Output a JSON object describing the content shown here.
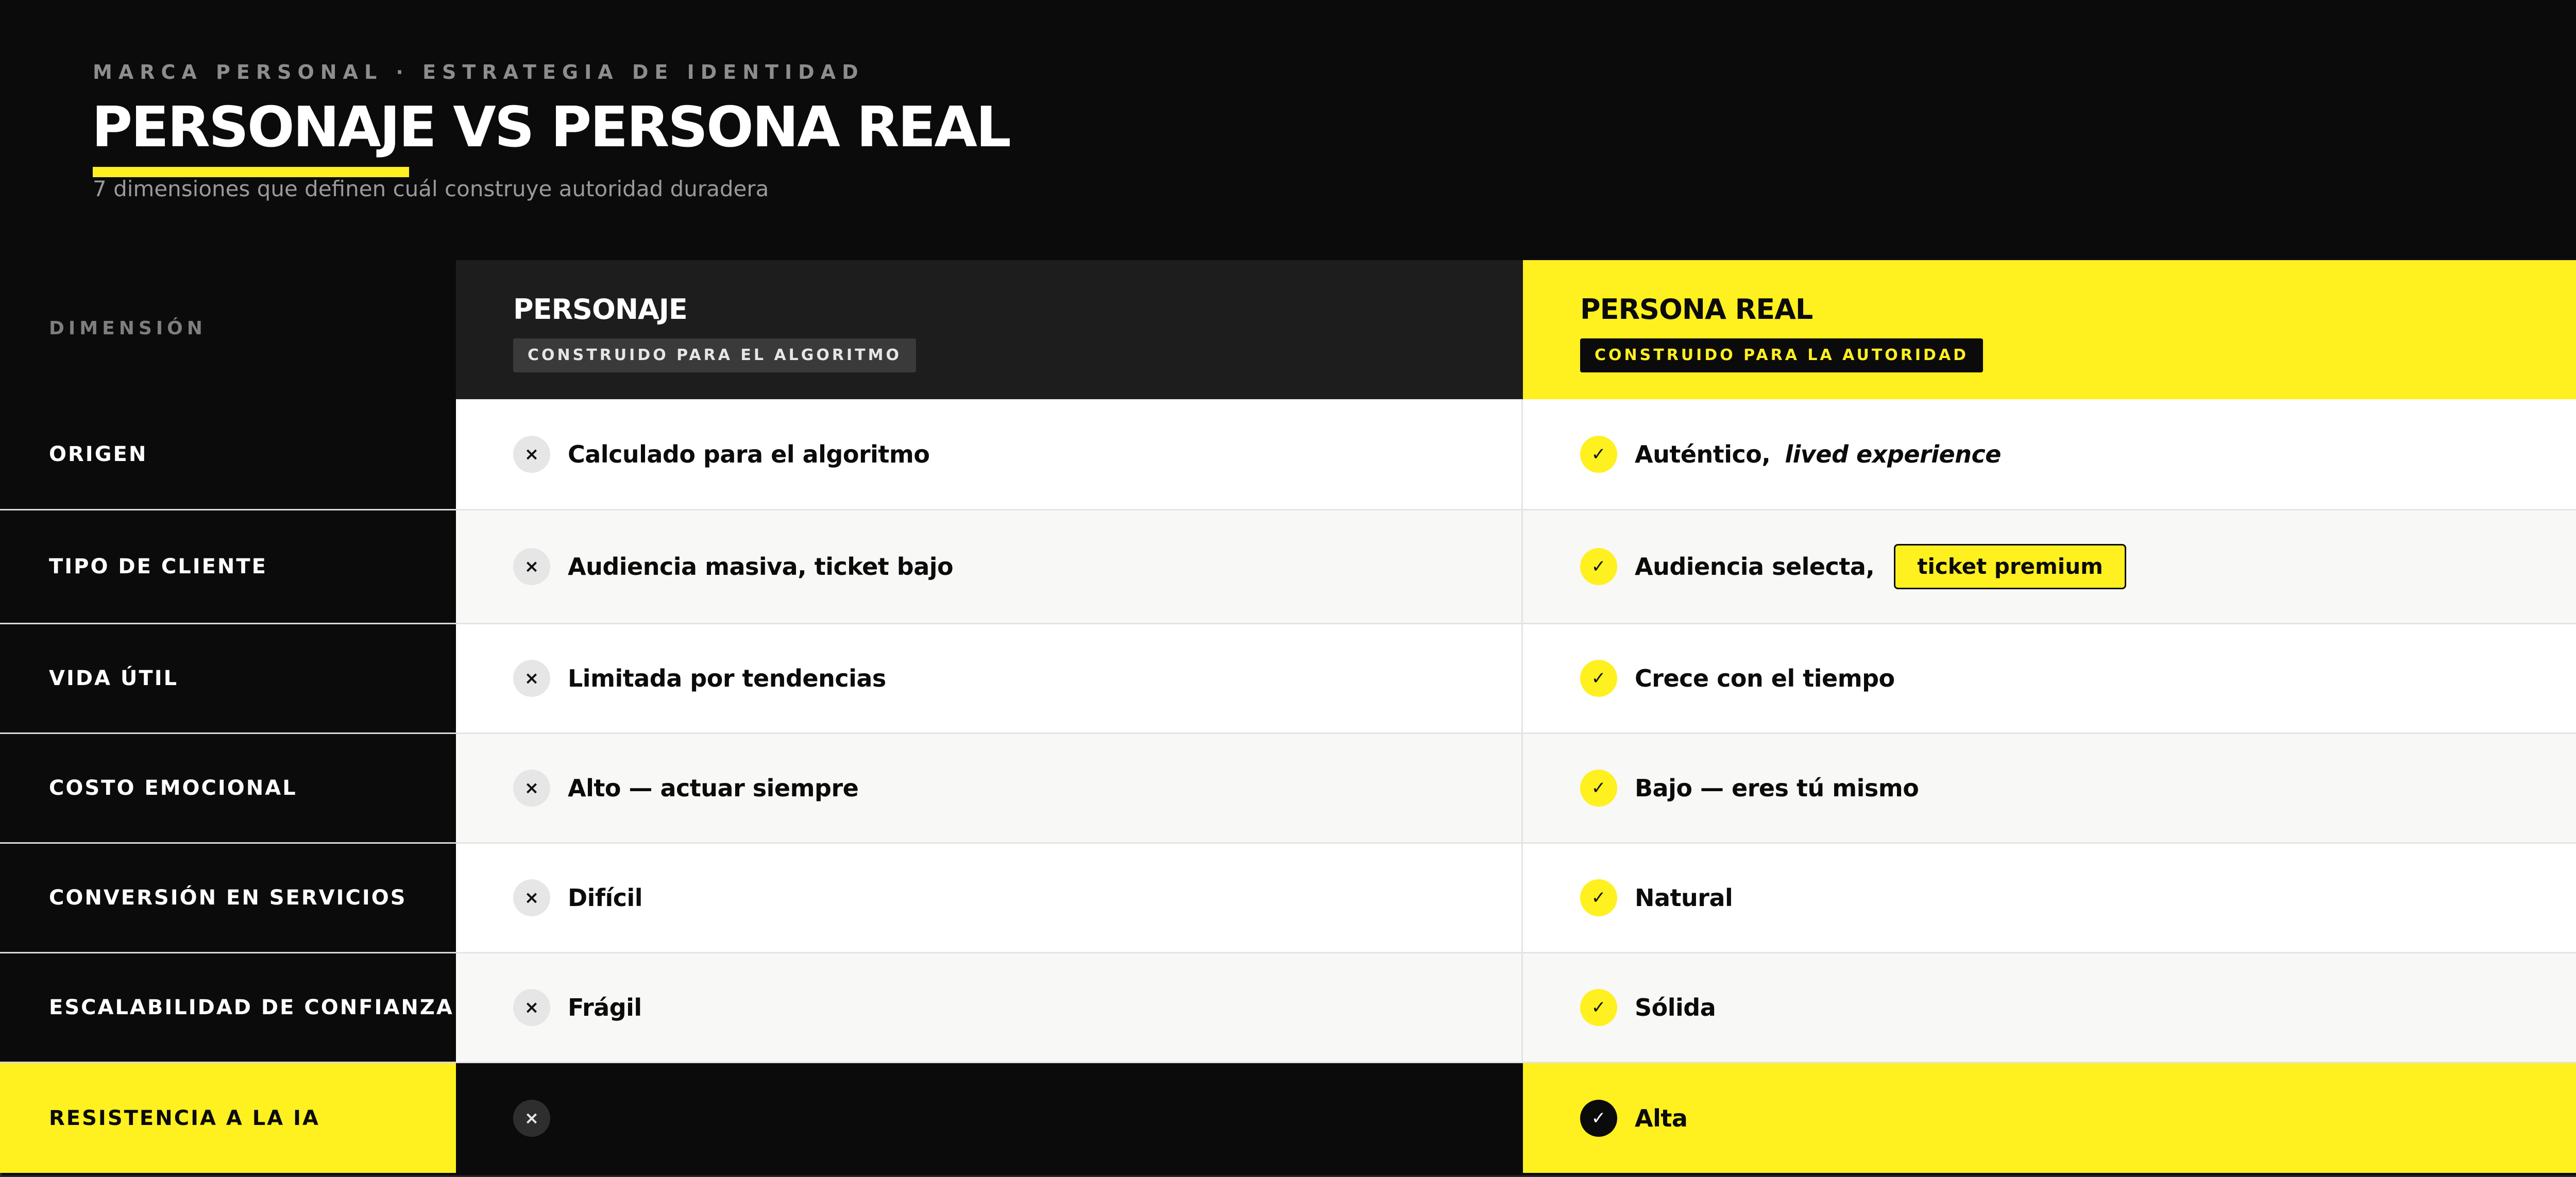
{
  "header": {
    "kicker": "MARCA PERSONAL · ESTRATEGIA DE IDENTIDAD",
    "title": "PERSONAJE VS PERSONA REAL",
    "subtitle": "7 dimensiones que definen cuál construye autoridad duradera"
  },
  "columns": {
    "dimension": "DIMENSIÓN",
    "personaje": {
      "title": "PERSONAJE",
      "tag": "CONSTRUIDO PARA EL ALGORITMO"
    },
    "persona_real": {
      "title": "PERSONA REAL",
      "tag": "CONSTRUIDO PARA LA AUTORIDAD"
    }
  },
  "icons": {
    "cross": "×",
    "check": "✓"
  },
  "colors": {
    "accent": "#fff01f",
    "dark": "#0b0b0b"
  },
  "rows": [
    {
      "dimension": "ORIGEN",
      "personaje": "Calculado para el algoritmo",
      "persona_real": "Auténtico,",
      "persona_real_em": "lived experience"
    },
    {
      "dimension": "TIPO DE CLIENTE",
      "personaje": "Audiencia masiva, ticket bajo",
      "persona_real": "Audiencia selecta,",
      "persona_real_pill": "ticket premium"
    },
    {
      "dimension": "VIDA ÚTIL",
      "personaje": "Limitada por tendencias",
      "persona_real": "Crece con el tiempo"
    },
    {
      "dimension": "COSTO EMOCIONAL",
      "personaje": "Alto — actuar siempre",
      "persona_real": "Bajo — eres tú mismo"
    },
    {
      "dimension": "CONVERSIÓN EN SERVICIOS",
      "personaje": "Difícil",
      "persona_real": "Natural"
    },
    {
      "dimension": "ESCALABILIDAD DE CONFIANZA",
      "personaje": "Frágil",
      "persona_real": "Sólida"
    },
    {
      "dimension": "RESISTENCIA A LA IA",
      "personaje": "",
      "persona_real": "Alta"
    }
  ]
}
